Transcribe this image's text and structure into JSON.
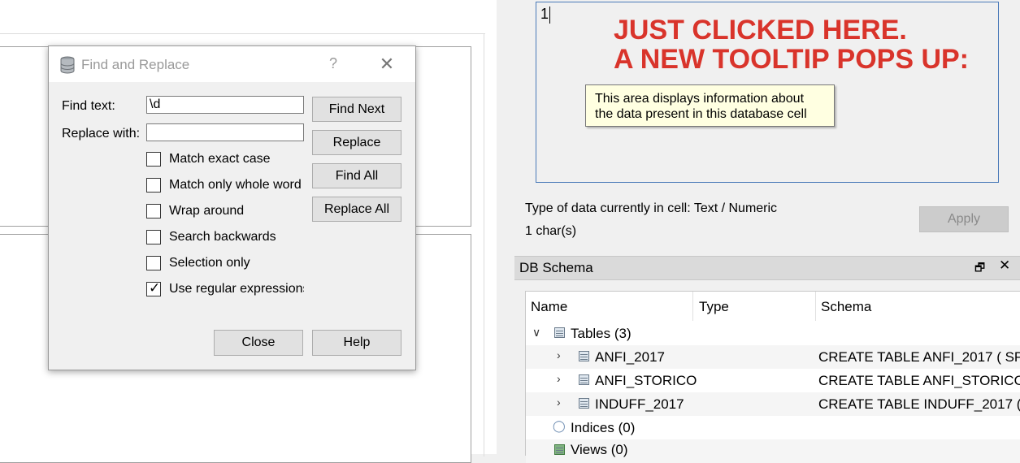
{
  "dialog": {
    "title": "Find and Replace",
    "help_glyph": "?",
    "close_glyph": "✕",
    "find_label": "Find text:",
    "find_value": "\\d",
    "replace_label": "Replace with:",
    "replace_value": "",
    "checkboxes": [
      {
        "label": "Match exact case",
        "checked": false
      },
      {
        "label": "Match only whole word",
        "checked": false
      },
      {
        "label": "Wrap around",
        "checked": false
      },
      {
        "label": "Search backwards",
        "checked": false
      },
      {
        "label": "Selection only",
        "checked": false
      },
      {
        "label": "Use regular expressions",
        "checked": true
      }
    ],
    "buttons": {
      "find_next": "Find Next",
      "replace": "Replace",
      "find_all": "Find All",
      "replace_all": "Replace All",
      "close": "Close",
      "help": "Help"
    }
  },
  "cell_editor": {
    "value": "1",
    "annotation": "JUST CLICKED HERE.\nA NEW TOOLTIP POPS UP:",
    "annotation_color": "#d9342b",
    "tooltip": "This area displays information about the data present in this database cell",
    "data_type": "Type of data currently in cell: Text / Numeric",
    "char_count": "1 char(s)",
    "apply_label": "Apply"
  },
  "schema": {
    "title": "DB Schema",
    "float_glyph": "🗗",
    "close_glyph": "✕",
    "columns": [
      "Name",
      "Type",
      "Schema"
    ],
    "rows": [
      {
        "name": "Tables (3)",
        "type": "",
        "schema": "",
        "level": 0,
        "arrow": "expanded"
      },
      {
        "name": "ANFI_2017",
        "type": "",
        "schema": "CREATE TABLE ANFI_2017 ( SP",
        "level": 1,
        "arrow": "collapsed"
      },
      {
        "name": "ANFI_STORICO",
        "type": "",
        "schema": "CREATE TABLE ANFI_STORICO",
        "level": 1,
        "arrow": "collapsed"
      },
      {
        "name": "INDUFF_2017",
        "type": "",
        "schema": "CREATE TABLE INDUFF_2017 (",
        "level": 1,
        "arrow": "collapsed"
      },
      {
        "name": "Indices (0)",
        "type": "",
        "schema": "",
        "level": 0,
        "arrow": "none"
      },
      {
        "name": "Views (0)",
        "type": "",
        "schema": "",
        "level": 0,
        "arrow": "none"
      }
    ]
  }
}
